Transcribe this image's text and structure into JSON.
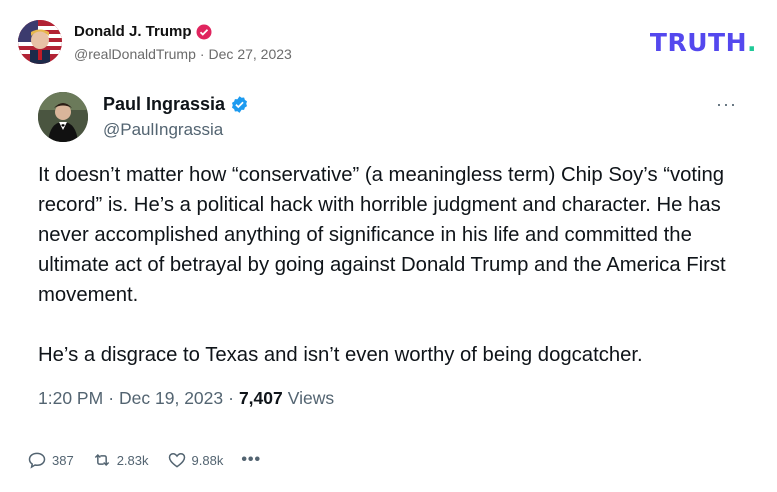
{
  "truth_post": {
    "author_name": "Donald J. Trump",
    "author_handle": "@realDonaldTrump",
    "separator": "·",
    "date": "Dec 27, 2023",
    "logo_text": "TRUTH",
    "logo_dot": "."
  },
  "tweet": {
    "author_name": "Paul Ingrassia",
    "author_handle": "@PaulIngrassia",
    "more_label": "···",
    "paragraphs": [
      "It doesn’t matter how “conservative” (a meaningless term) Chip Soy’s “voting record” is. He’s a political hack with horrible judgment and character. He has never accomplished anything of significance in his life and committed the ultimate act of betrayal by going against Donald Trump and the America First movement.",
      "He’s a disgrace to Texas and isn’t even worthy of being dogcatcher."
    ],
    "time": "1:20 PM",
    "separator": "·",
    "date": "Dec 19, 2023",
    "views_count": "7,407",
    "views_label": "Views",
    "actions": {
      "replies": "387",
      "reposts": "2.83k",
      "likes": "9.88k",
      "more": "•••"
    }
  },
  "colors": {
    "truth_brand": "#5448ee",
    "truth_dot": "#20c997",
    "verified_badge_truth": "#e0245e",
    "verified_badge_x": "#1d9bf0",
    "secondary_text": "#536471"
  },
  "icons": [
    "verified-badge-icon",
    "reply-icon",
    "repost-icon",
    "like-icon",
    "more-icon"
  ]
}
